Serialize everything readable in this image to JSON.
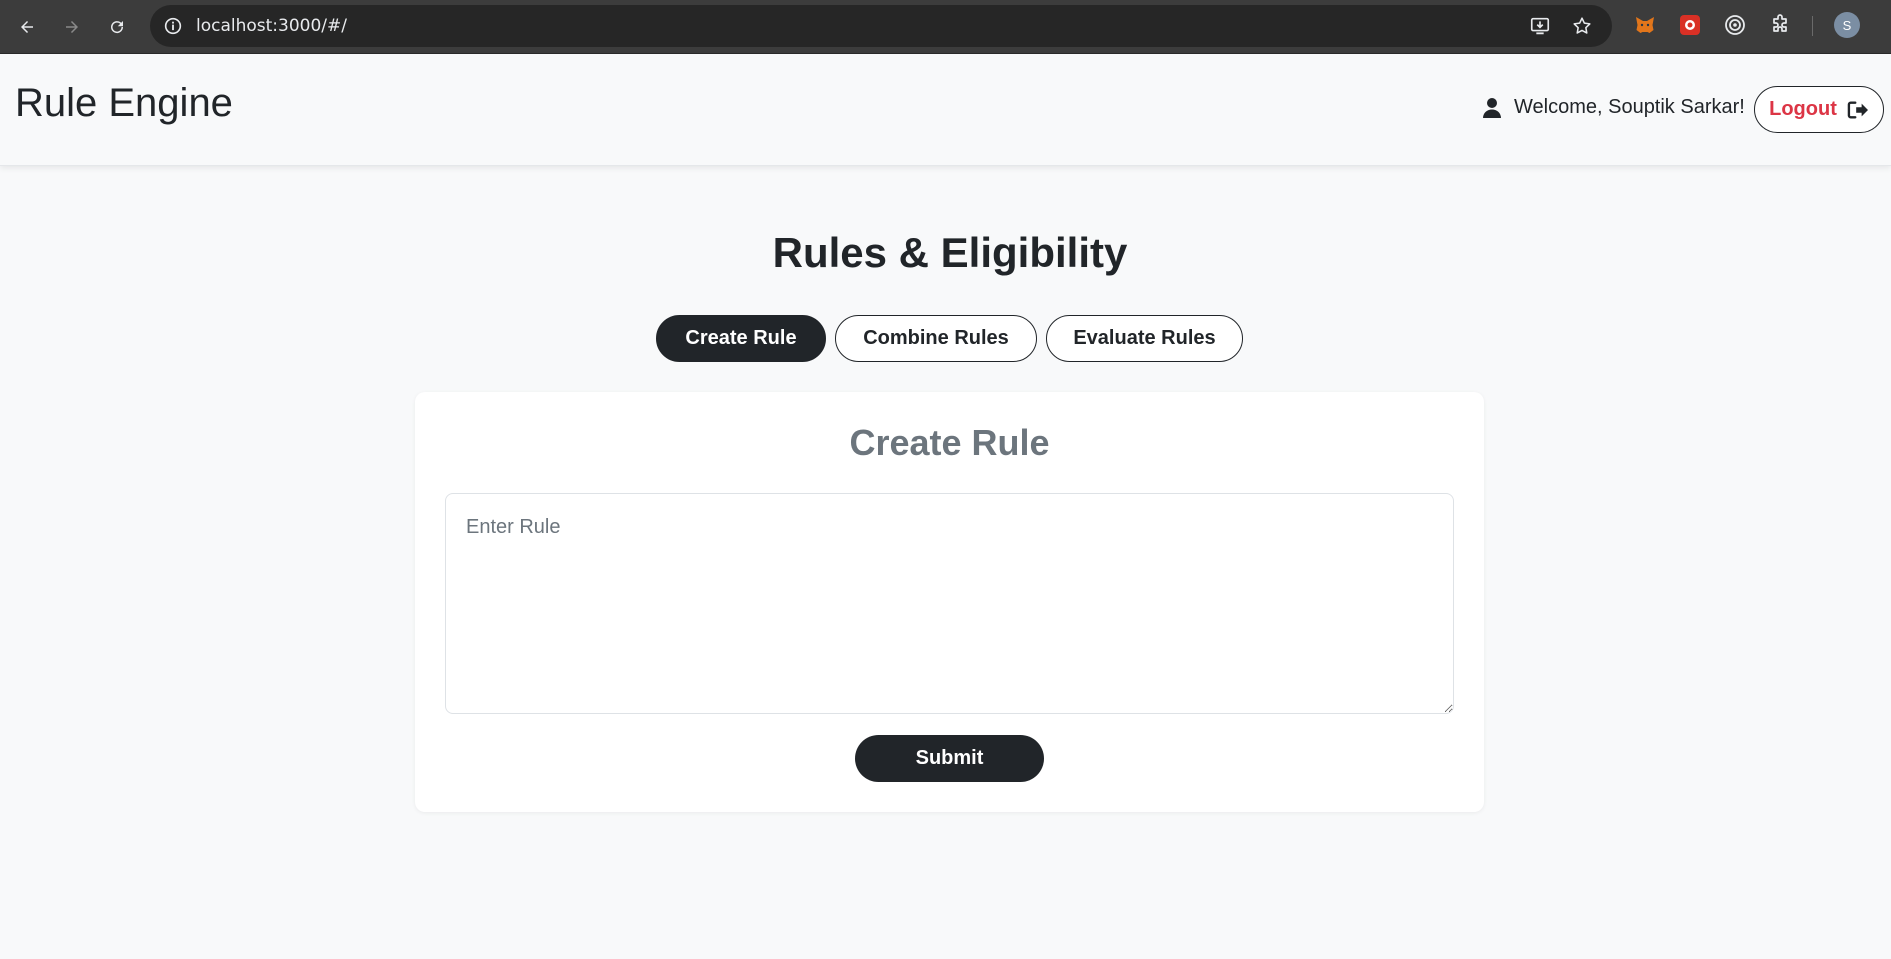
{
  "browser": {
    "url": "localhost:3000/#/",
    "profile_initial": "S",
    "icons": [
      "back-arrow-icon",
      "forward-arrow-icon",
      "reload-icon",
      "site-info-icon",
      "install-app-icon",
      "bookmark-star-icon",
      "metamask-extension-icon",
      "red-extension-icon",
      "target-extension-icon",
      "extensions-puzzle-icon"
    ]
  },
  "header": {
    "brand": "Rule Engine",
    "welcome": "Welcome, Souptik Sarkar!",
    "logout_label": "Logout",
    "logout_color": "#dc3545"
  },
  "main": {
    "title": "Rules & Eligibility",
    "tabs": [
      {
        "label": "Create Rule",
        "active": true
      },
      {
        "label": "Combine Rules",
        "active": false
      },
      {
        "label": "Evaluate Rules",
        "active": false
      }
    ]
  },
  "card": {
    "title": "Create Rule",
    "rule_input_placeholder": "Enter Rule",
    "rule_input_value": "",
    "submit_label": "Submit"
  },
  "colors": {
    "primary_dark": "#212529",
    "muted": "#6c757d",
    "background": "#f8f9fa"
  }
}
